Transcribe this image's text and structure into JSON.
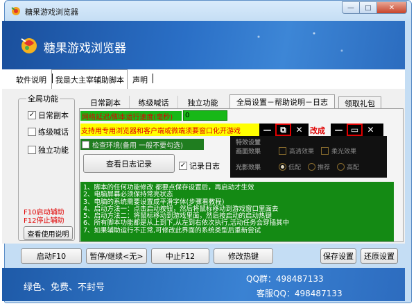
{
  "window": {
    "title": "糖果游戏浏览器",
    "controls": {
      "minimize": "—",
      "maximize": "□",
      "close": "✕"
    }
  },
  "banner": {
    "app_title": "糖果游戏浏览器"
  },
  "menu": {
    "items": [
      {
        "label": "软件说明"
      },
      {
        "label": "我是大主宰辅助脚本"
      },
      {
        "label": "声明"
      }
    ]
  },
  "left_group": {
    "title": "全局功能",
    "checkboxes": [
      {
        "label": "日常副本",
        "checked": true
      },
      {
        "label": "练级喊话",
        "checked": false
      },
      {
        "label": "独立功能",
        "checked": false
      }
    ],
    "hotkeys": [
      "F10启动辅助",
      "F12停止辅助"
    ],
    "help_button": "查看使用说明"
  },
  "tabs": [
    {
      "label": "日常副本"
    },
    {
      "label": "练级喊话"
    },
    {
      "label": "独立功能"
    },
    {
      "label": "全局设置－帮助说明－日志"
    },
    {
      "label": "领取礼包"
    }
  ],
  "panel": {
    "delay_label": "网络延迟/脚本运行速度(毫秒)",
    "delay_value": "0",
    "browser_note": "支持用专用浏览器和客户端或微端须要窗口化开游戏",
    "window_controls": [
      "—",
      "⧉",
      "✕"
    ],
    "modify_label": "改成",
    "window_controls_2": [
      "—",
      "▭",
      "✕"
    ],
    "check_env_label": "检查环境(备用 一般不要勾选)",
    "view_log_button": "查看日志记录",
    "record_log_label": "记录日志",
    "record_log_checked": true,
    "effects": {
      "title": "特效设置",
      "picture_label": "画面效果",
      "hd_label": "高清效果",
      "soft_label": "柔光效果",
      "light_label": "光影效果",
      "low_label": "低配",
      "rec_label": "推荐",
      "high_label": "高配",
      "selected_light": "低配"
    },
    "info_lines": [
      "1、脚本的任何功能修改 都要点保存设置后，再启动才生效",
      "2、电脑屏幕必须保持常亮状态",
      "3、电脑的系统需要设置成平滑字体(步骤看教程)",
      "4、启动方法一：点击启动按钮，然后将鼠标移动到游戏窗口里面去",
      "5、启动方法二：将鼠标移动到游戏里面，然后按启动的启动热键",
      "6、所有脚本功能都是从上到下,从左到右依次执行,活动任务会穿插其中",
      "7、如果辅助运行不正常,可修改此界面的系统类型后重新尝试"
    ]
  },
  "buttons": {
    "start": "启动F10",
    "pause": "暂停/继续<无>",
    "stop": "中止F12",
    "hotkey": "修改热键",
    "save": "保存设置",
    "restore": "还原设置"
  },
  "footer": {
    "slogan": "绿色、免费、不封号",
    "qq_group": "QQ群：498487133",
    "service_qq": "客服QQ：498487133"
  },
  "colors": {
    "accent_blue": "#2a6fc6",
    "info_green": "#148a14",
    "label_green": "#17b817",
    "warn_red": "#e00000",
    "note_yellow": "#ffff00"
  }
}
